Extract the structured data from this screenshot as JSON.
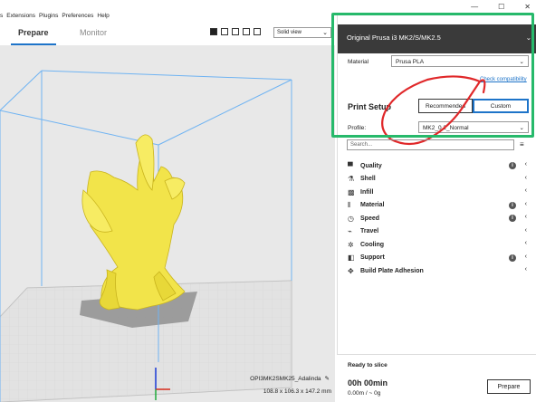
{
  "menubar": {
    "items": [
      "s",
      "Extensions",
      "Plugins",
      "Preferences",
      "Help"
    ]
  },
  "window_controls": {
    "minimize": "—",
    "maximize": "☐",
    "close": "✕"
  },
  "tabs": {
    "prepare": "Prepare",
    "monitor": "Monitor"
  },
  "view": {
    "selected": "Solid view"
  },
  "model": {
    "name": "OPI3MK2SMK25_Adalinda",
    "dimensions": "108.8 x 106.3 x 147.2 mm"
  },
  "printer": {
    "name": "Original Prusa i3 MK2/S/MK2.5"
  },
  "material": {
    "label": "Material",
    "value": "Prusa PLA",
    "check_link": "Check compatibility"
  },
  "print_setup": {
    "title": "Print Setup",
    "recommended_label": "Recommended",
    "custom_label": "Custom",
    "profile_label": "Profile:",
    "profile_value": "MK2_0.2_Normal"
  },
  "search": {
    "placeholder": "Search..."
  },
  "settings": [
    {
      "label": "Quality",
      "icon": "quality-icon",
      "info": true
    },
    {
      "label": "Shell",
      "icon": "shell-icon",
      "info": false
    },
    {
      "label": "Infill",
      "icon": "infill-icon",
      "info": false
    },
    {
      "label": "Material",
      "icon": "material-icon",
      "info": true
    },
    {
      "label": "Speed",
      "icon": "speed-icon",
      "info": true
    },
    {
      "label": "Travel",
      "icon": "travel-icon",
      "info": false
    },
    {
      "label": "Cooling",
      "icon": "cooling-icon",
      "info": false
    },
    {
      "label": "Support",
      "icon": "support-icon",
      "info": true
    },
    {
      "label": "Build Plate Adhesion",
      "icon": "adhesion-icon",
      "info": false
    }
  ],
  "status": {
    "ready": "Ready to slice",
    "time": "00h 00min",
    "usage": "0.00m / ~ 0g",
    "prepare_button": "Prepare"
  },
  "colors": {
    "accent": "#1e74c9",
    "highlight": "#27b96b",
    "header": "#3a3a3a",
    "model": "#f2e44a"
  }
}
